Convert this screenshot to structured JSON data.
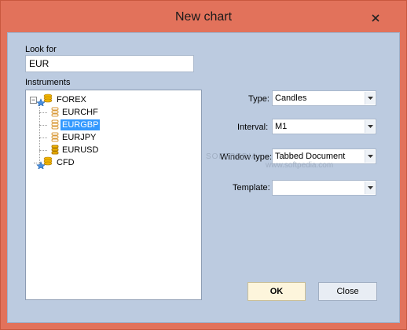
{
  "window": {
    "title": "New chart",
    "titlebar_color": "#e2725b",
    "client_color": "#bccbe0"
  },
  "search": {
    "label": "Look for",
    "value": "EUR"
  },
  "instruments": {
    "label": "Instruments",
    "groups": [
      {
        "name": "FOREX",
        "expanded": true,
        "expander": "−",
        "items": [
          {
            "name": "EURCHF",
            "selected": false
          },
          {
            "name": "EURGBP",
            "selected": true
          },
          {
            "name": "EURJPY",
            "selected": false
          },
          {
            "name": "EURUSD",
            "selected": false
          }
        ]
      },
      {
        "name": "CFD",
        "expanded": false,
        "items": []
      }
    ],
    "selection_color": "#3399ff"
  },
  "settings": {
    "type": {
      "label": "Type:",
      "value": "Candles"
    },
    "interval": {
      "label": "Interval:",
      "value": "M1"
    },
    "window_type": {
      "label": "Window type:",
      "value": "Tabbed Document"
    },
    "template": {
      "label": "Template:",
      "value": ""
    }
  },
  "buttons": {
    "ok": "OK",
    "close": "Close"
  },
  "watermark": {
    "text": "SOFTPEDIA",
    "url": "www.softpedia.com"
  },
  "icons": {
    "close": "close-icon",
    "folder": "folder-star-icon",
    "instrument": "coin-stack-icon",
    "dropdown": "chevron-down-icon"
  }
}
